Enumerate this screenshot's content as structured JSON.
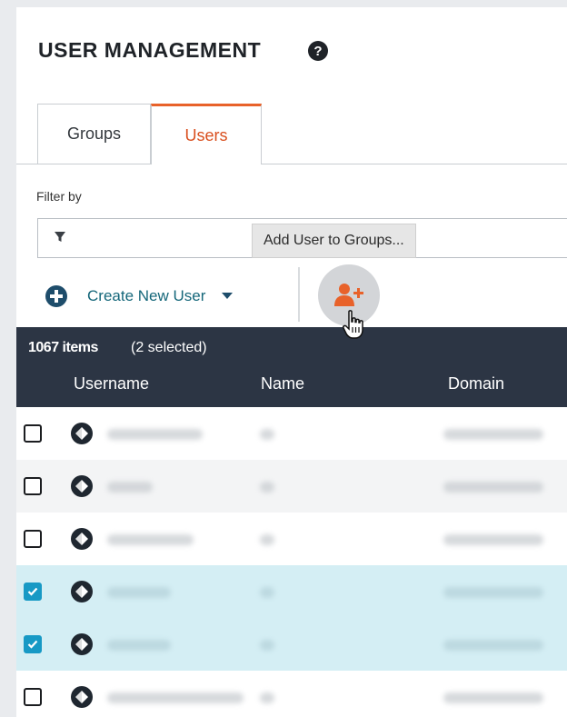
{
  "page": {
    "title": "USER MANAGEMENT",
    "tabs": [
      {
        "label": "Groups",
        "active": false
      },
      {
        "label": "Users",
        "active": true
      }
    ],
    "filter_label": "Filter by",
    "filter_value": ""
  },
  "toolbar": {
    "create_label": "Create New User",
    "tooltip": "Add User to Groups..."
  },
  "table": {
    "count": "1067 items",
    "selected": "(2 selected)",
    "columns": [
      "Username",
      "Name",
      "Domain"
    ],
    "rows": [
      {
        "checked": false,
        "style": "plain"
      },
      {
        "checked": false,
        "style": "alt"
      },
      {
        "checked": false,
        "style": "plain"
      },
      {
        "checked": true,
        "style": "sel"
      },
      {
        "checked": true,
        "style": "sel"
      },
      {
        "checked": false,
        "style": "plain"
      }
    ]
  },
  "colors": {
    "accent": "#e8622a",
    "header_bg": "#2c3544",
    "link": "#15677a",
    "selected_row": "#d4eef4",
    "check": "#1799c5"
  }
}
